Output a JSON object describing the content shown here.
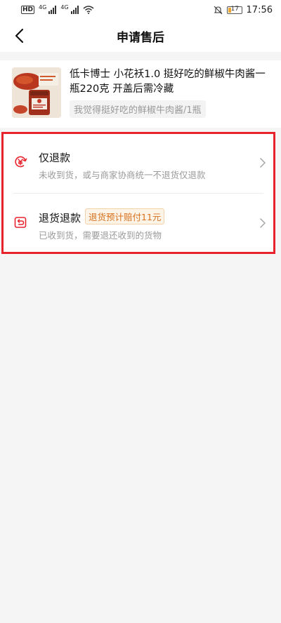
{
  "status_bar": {
    "hd_label": "HD",
    "network_1": "4G",
    "network_2": "4G",
    "battery": "17",
    "time": "17:56"
  },
  "header": {
    "title": "申请售后",
    "back_icon": "chevron-left-icon"
  },
  "product": {
    "name": "低卡博士 小花袄1.0 挺好吃的鲜椒牛肉酱一瓶220克 开盖后需冷藏",
    "spec": "我觉得挺好吃的鲜椒牛肉酱/1瓶"
  },
  "options": [
    {
      "title": "仅退款",
      "description": "未收到货，或与商家协商统一不退货仅退款",
      "icon": "refund-yen-icon"
    },
    {
      "title": "退货退款",
      "badge": "退货预计赔付11元",
      "description": "已收到货，需要退还收到的货物",
      "icon": "return-box-icon"
    }
  ],
  "colors": {
    "accent_red": "#e8232d",
    "badge_orange": "#d6721f"
  }
}
